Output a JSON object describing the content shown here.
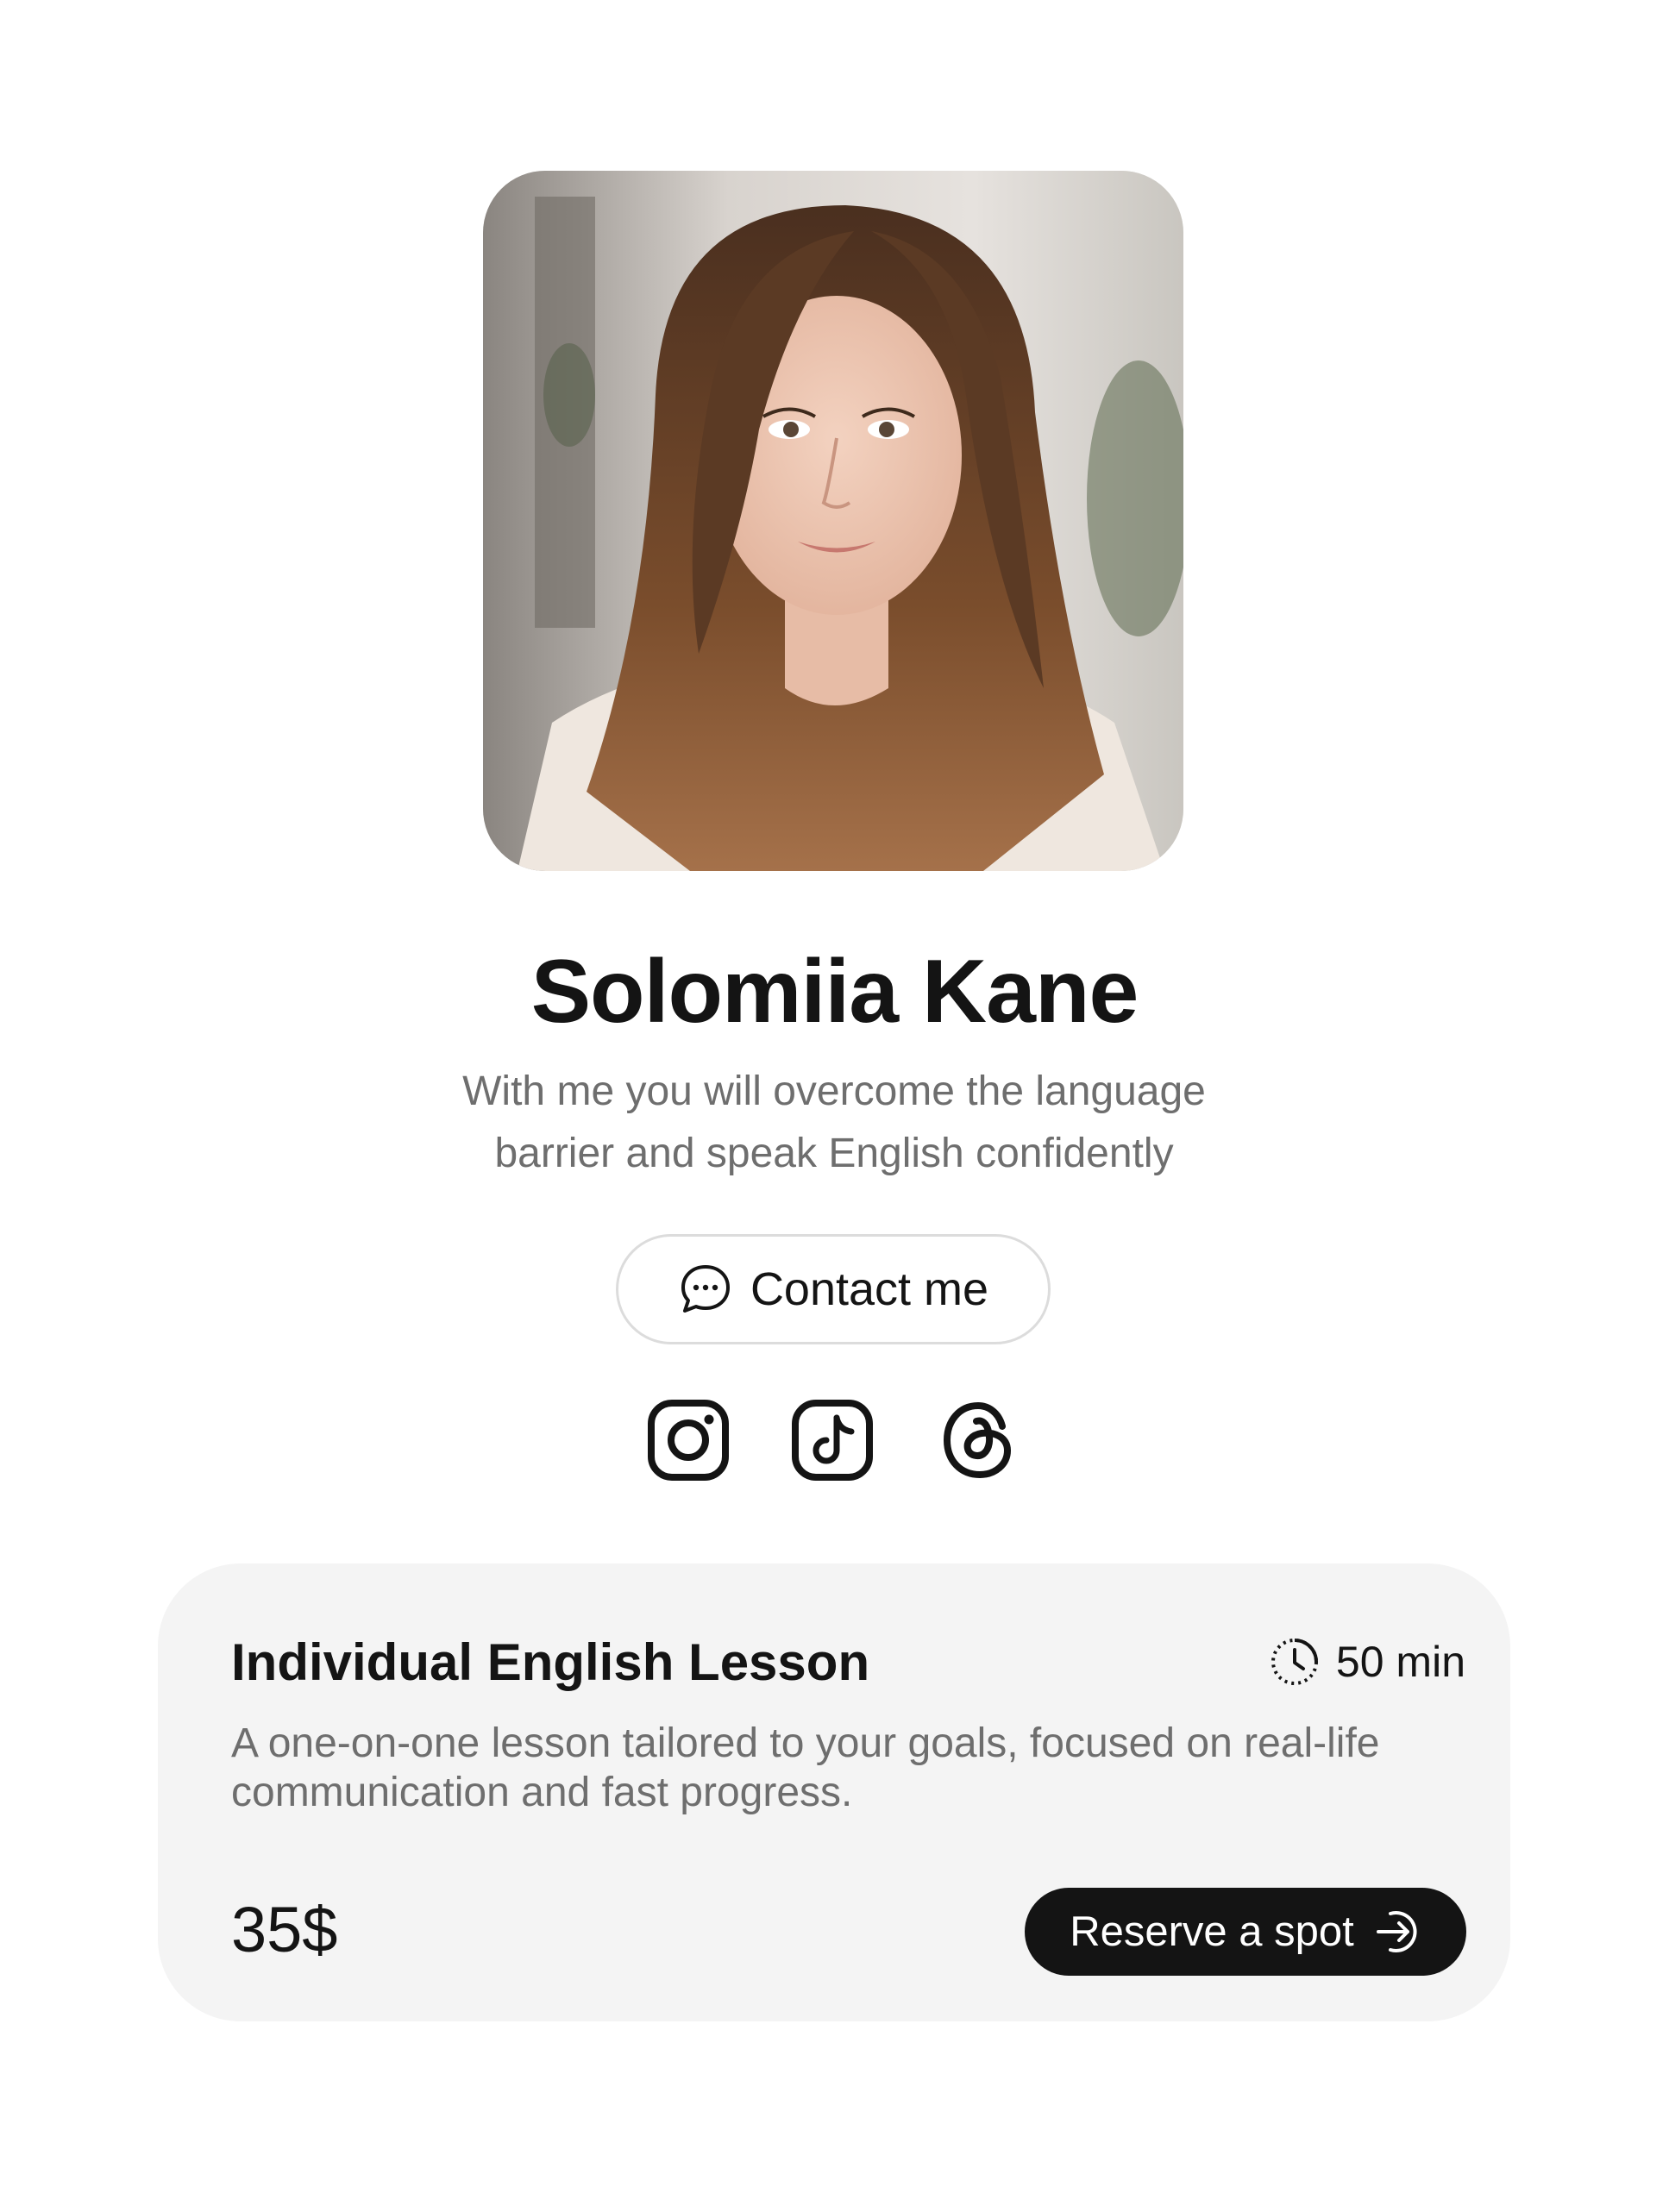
{
  "profile": {
    "name": "Solomiia Kane",
    "tagline": "With me you will overcome the language barrier and speak English confidently",
    "photo": "portrait-photo"
  },
  "contact": {
    "label": "Contact me",
    "icon": "chat-bubble-icon"
  },
  "socials": [
    {
      "name": "Instagram",
      "icon": "instagram-icon"
    },
    {
      "name": "TikTok",
      "icon": "tiktok-icon"
    },
    {
      "name": "Threads",
      "icon": "threads-icon"
    }
  ],
  "service": {
    "title": "Individual English Lesson",
    "duration": "50 min",
    "duration_icon": "clock-icon",
    "description": "A one-on-one lesson tailored to your goals, focused on real-life communication and fast progress.",
    "price": "35$",
    "cta_label": "Reserve a spot",
    "cta_icon": "arrow-right-circle-icon"
  },
  "colors": {
    "background": "#ffffff",
    "card": "#f4f4f4",
    "primary_text": "#141414",
    "secondary_text": "#6e6e6e",
    "button_dark": "#141414",
    "border": "#dcdcdc"
  }
}
